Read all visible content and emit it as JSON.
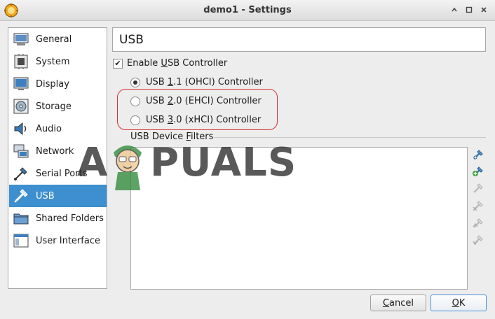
{
  "window": {
    "title": "demo1 - Settings"
  },
  "sidebar": {
    "items": [
      {
        "label": "General",
        "icon": "general-icon"
      },
      {
        "label": "System",
        "icon": "system-icon"
      },
      {
        "label": "Display",
        "icon": "display-icon"
      },
      {
        "label": "Storage",
        "icon": "storage-icon"
      },
      {
        "label": "Audio",
        "icon": "audio-icon"
      },
      {
        "label": "Network",
        "icon": "network-icon"
      },
      {
        "label": "Serial Ports",
        "icon": "serial-ports-icon"
      },
      {
        "label": "USB",
        "icon": "usb-icon",
        "selected": true
      },
      {
        "label": "Shared Folders",
        "icon": "shared-folders-icon"
      },
      {
        "label": "User Interface",
        "icon": "user-interface-icon"
      }
    ]
  },
  "page": {
    "title": "USB"
  },
  "usb": {
    "enable_label_pre": "Enable ",
    "enable_label_u": "U",
    "enable_label_post": "SB Controller",
    "enable_checked": true,
    "options": [
      {
        "pre": "USB ",
        "u": "1",
        "post": ".1 (OHCI) Controller",
        "checked": true
      },
      {
        "pre": "USB ",
        "u": "2",
        "post": ".0 (EHCI) Controller",
        "checked": false
      },
      {
        "pre": "USB ",
        "u": "3",
        "post": ".0 (xHCI) Controller",
        "checked": false
      }
    ],
    "filters_label_pre": "USB Device ",
    "filters_label_u": "F",
    "filters_label_post": "ilters"
  },
  "watermark": {
    "left": "A",
    "right": "PUALS"
  },
  "buttons": {
    "cancel_u": "C",
    "cancel_rest": "ancel",
    "ok_u": "O",
    "ok_rest": "K"
  },
  "colors": {
    "selection": "#3d8fcf",
    "highlight_ring": "#d63333"
  }
}
